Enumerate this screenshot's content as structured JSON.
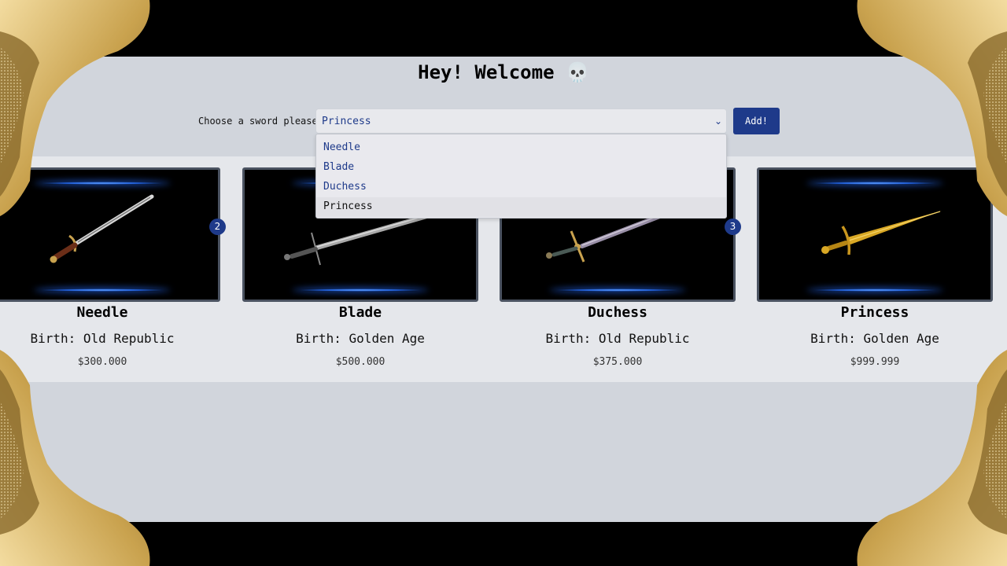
{
  "header": {
    "title": "Hey! Welcome",
    "title_icon": "💀"
  },
  "picker": {
    "label": "Choose a sword please",
    "selected": "Princess",
    "add_label": "Add!",
    "options": [
      "Needle",
      "Blade",
      "Duchess",
      "Princess"
    ]
  },
  "cards": [
    {
      "name": "Needle",
      "birth": "Birth: Old Republic",
      "price": "$300.000",
      "badge": "2"
    },
    {
      "name": "Blade",
      "birth": "Birth: Golden Age",
      "price": "$500.000",
      "badge": ""
    },
    {
      "name": "Duchess",
      "birth": "Birth: Old Republic",
      "price": "$375.000",
      "badge": "3"
    },
    {
      "name": "Princess",
      "birth": "Birth: Golden Age",
      "price": "$999.999",
      "badge": ""
    }
  ],
  "colors": {
    "accent": "#1e3a8a",
    "page": "#d1d5dc",
    "gallery": "#e5e7eb",
    "gold": "#c9a24e"
  },
  "icons": {
    "select_chevron": "chevron-down-icon",
    "decor": "gold-wave-ornament"
  }
}
